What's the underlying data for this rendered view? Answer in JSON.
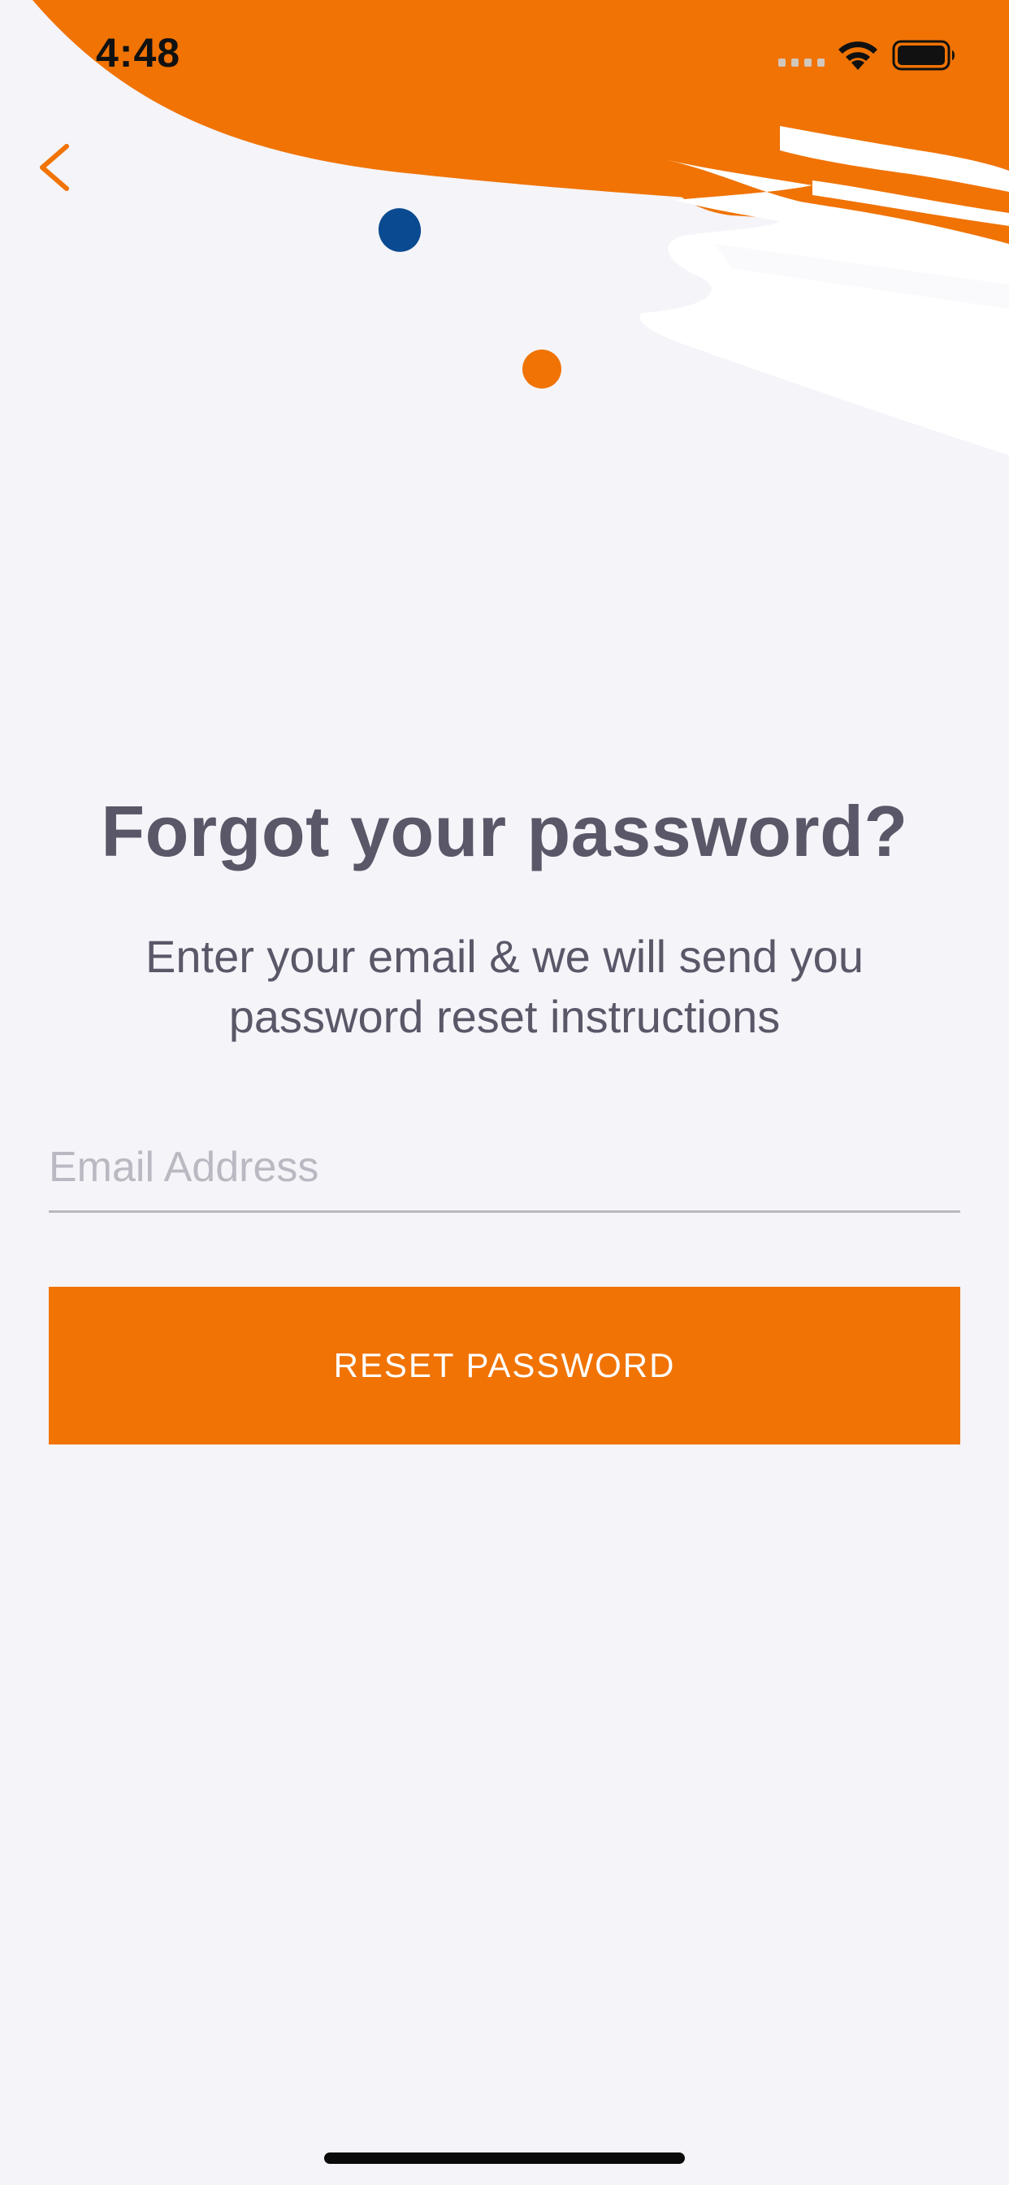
{
  "status_bar": {
    "time": "4:48",
    "signal_icon": "cellular-signal-icon",
    "wifi_icon": "wifi-icon",
    "battery_icon": "battery-icon"
  },
  "nav": {
    "back_icon": "chevron-left-icon"
  },
  "content": {
    "title": "Forgot your password?",
    "subtitle": "Enter your email & we will send you password reset instructions"
  },
  "form": {
    "email_placeholder": "Email Address",
    "email_value": "",
    "reset_button_label": "RESET PASSWORD"
  },
  "colors": {
    "accent": "#f07304",
    "secondary_dot": "#0a4a90",
    "background": "#f5f4f9",
    "text": "#5a5768"
  }
}
